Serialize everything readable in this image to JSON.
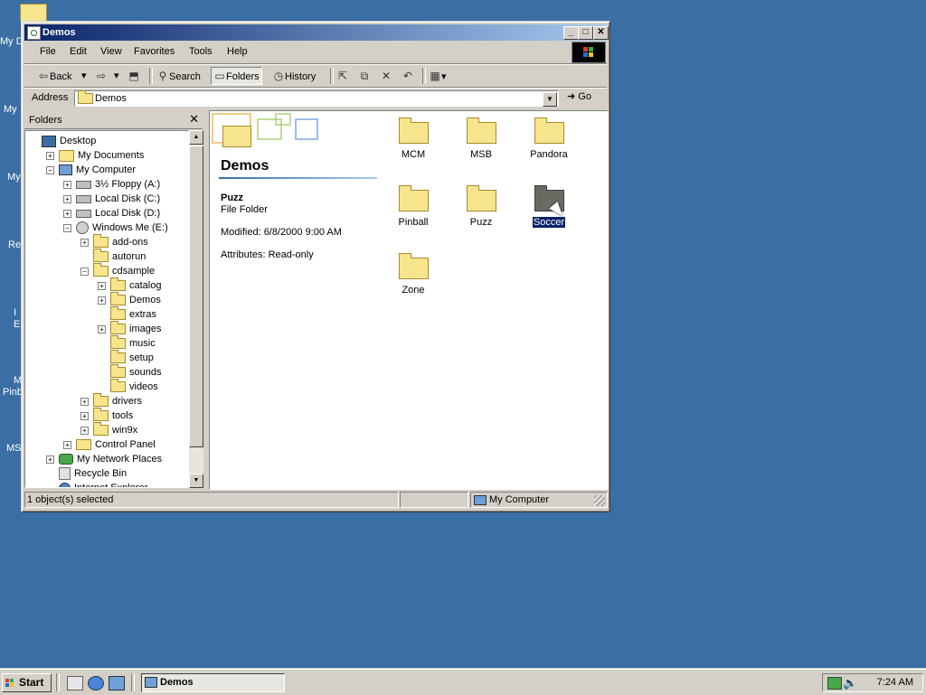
{
  "desktop": {
    "fragments": [
      "My D",
      "My",
      "My",
      "Re",
      "I",
      "E",
      "M",
      "Pinb",
      "MS"
    ]
  },
  "window": {
    "title": "Demos",
    "buttons": {
      "minimize": "_",
      "maximize": "□",
      "close": "✕"
    },
    "menu": [
      "File",
      "Edit",
      "View",
      "Favorites",
      "Tools",
      "Help"
    ],
    "toolbar": {
      "back": "Back",
      "search": "Search",
      "folders": "Folders",
      "history": "History"
    },
    "address": {
      "label": "Address",
      "value": "Demos",
      "go": "Go"
    },
    "folders_pane": {
      "title": "Folders",
      "close": "✕",
      "tree": [
        {
          "label": "Desktop",
          "icon": "desktop-icon",
          "depth": 0,
          "toggle": ""
        },
        {
          "label": "My Documents",
          "icon": "documents-icon",
          "depth": 1,
          "toggle": "+"
        },
        {
          "label": "My Computer",
          "icon": "computer-icon",
          "depth": 1,
          "toggle": "-"
        },
        {
          "label": "3½ Floppy (A:)",
          "icon": "floppy-icon",
          "depth": 2,
          "toggle": "+"
        },
        {
          "label": "Local Disk (C:)",
          "icon": "drive-icon",
          "depth": 2,
          "toggle": "+"
        },
        {
          "label": "Local Disk (D:)",
          "icon": "drive-icon",
          "depth": 2,
          "toggle": "+"
        },
        {
          "label": "Windows Me (E:)",
          "icon": "cd-icon",
          "depth": 2,
          "toggle": "-"
        },
        {
          "label": "add-ons",
          "icon": "folder-icon",
          "depth": 3,
          "toggle": "+"
        },
        {
          "label": "autorun",
          "icon": "folder-icon",
          "depth": 3,
          "toggle": ""
        },
        {
          "label": "cdsample",
          "icon": "folder-icon",
          "depth": 3,
          "toggle": "-"
        },
        {
          "label": "catalog",
          "icon": "folder-icon",
          "depth": 4,
          "toggle": "+"
        },
        {
          "label": "Demos",
          "icon": "folder-icon",
          "depth": 4,
          "toggle": "+"
        },
        {
          "label": "extras",
          "icon": "folder-icon",
          "depth": 4,
          "toggle": ""
        },
        {
          "label": "images",
          "icon": "folder-icon",
          "depth": 4,
          "toggle": "+"
        },
        {
          "label": "music",
          "icon": "folder-icon",
          "depth": 4,
          "toggle": ""
        },
        {
          "label": "setup",
          "icon": "folder-icon",
          "depth": 4,
          "toggle": ""
        },
        {
          "label": "sounds",
          "icon": "folder-icon",
          "depth": 4,
          "toggle": ""
        },
        {
          "label": "videos",
          "icon": "folder-icon",
          "depth": 4,
          "toggle": ""
        },
        {
          "label": "drivers",
          "icon": "folder-icon",
          "depth": 3,
          "toggle": "+"
        },
        {
          "label": "tools",
          "icon": "folder-icon",
          "depth": 3,
          "toggle": "+"
        },
        {
          "label": "win9x",
          "icon": "folder-icon",
          "depth": 3,
          "toggle": "+"
        },
        {
          "label": "Control Panel",
          "icon": "control-panel-icon",
          "depth": 2,
          "toggle": "+"
        },
        {
          "label": "My Network Places",
          "icon": "network-icon",
          "depth": 1,
          "toggle": "+"
        },
        {
          "label": "Recycle Bin",
          "icon": "recycle-bin-icon",
          "depth": 1,
          "toggle": ""
        },
        {
          "label": "Internet Explorer",
          "icon": "ie-icon",
          "depth": 1,
          "toggle": ""
        }
      ]
    },
    "content": {
      "folder_title": "Demos",
      "details": {
        "name": "Puzz",
        "type": "File Folder",
        "modified": "Modified: 6/8/2000 9:00 AM",
        "attributes": "Attributes: Read-only"
      },
      "items": [
        {
          "label": "MCM",
          "selected": false
        },
        {
          "label": "MSB",
          "selected": false
        },
        {
          "label": "Pandora",
          "selected": false
        },
        {
          "label": "Pinball",
          "selected": false
        },
        {
          "label": "Puzz",
          "selected": false
        },
        {
          "label": "Soccer",
          "selected": true
        },
        {
          "label": "Zone",
          "selected": false
        }
      ]
    },
    "status": {
      "left": "1 object(s) selected",
      "middle": "",
      "zone": "My Computer"
    }
  },
  "taskbar": {
    "start": "Start",
    "task": "Demos",
    "clock": "7:24 AM"
  },
  "colors": {
    "desktop": "#3a6ea5",
    "title_active": "#0a246a",
    "face": "#d4d0c8",
    "selection": "#0a246a"
  }
}
